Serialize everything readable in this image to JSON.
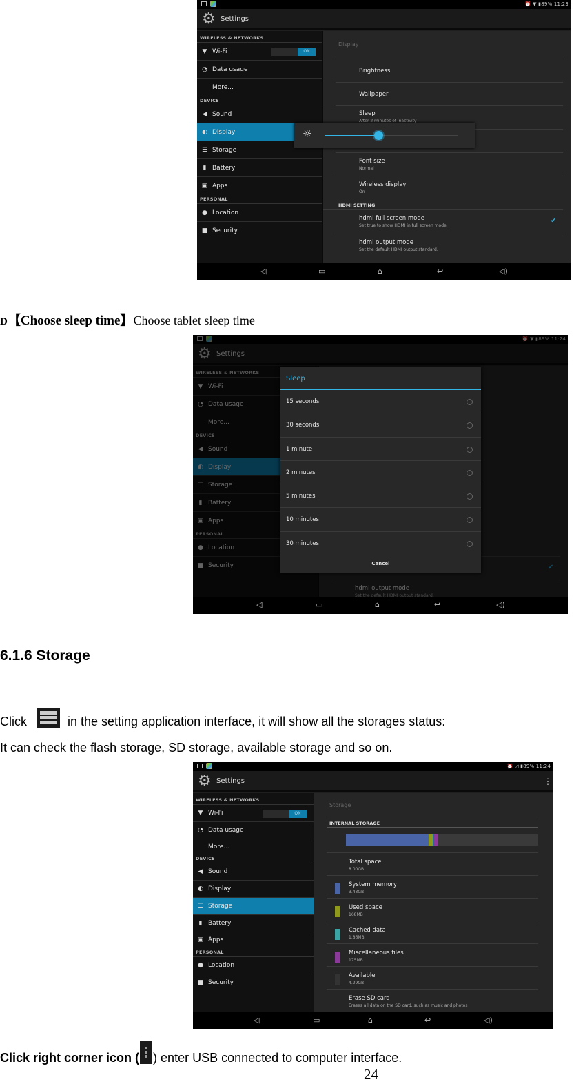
{
  "screen1": {
    "status": {
      "time": "11:23",
      "battery": "89%"
    },
    "app_title": "Settings",
    "sidebar": {
      "sections": [
        {
          "label": "WIRELESS & NETWORKS",
          "items": [
            {
              "label": "Wi-Fi",
              "icon": "wifi-icon",
              "toggle": "ON"
            },
            {
              "label": "Data usage",
              "icon": "data-usage-icon"
            },
            {
              "label": "More...",
              "icon": ""
            }
          ]
        },
        {
          "label": "DEVICE",
          "items": [
            {
              "label": "Sound",
              "icon": "sound-icon"
            },
            {
              "label": "Display",
              "icon": "display-icon",
              "selected": true
            },
            {
              "label": "Storage",
              "icon": "storage-icon"
            },
            {
              "label": "Battery",
              "icon": "battery-icon"
            },
            {
              "label": "Apps",
              "icon": "apps-icon"
            }
          ]
        },
        {
          "label": "PERSONAL",
          "items": [
            {
              "label": "Location",
              "icon": "location-icon"
            },
            {
              "label": "Security",
              "icon": "lock-icon"
            }
          ]
        }
      ]
    },
    "main": {
      "header": "Display",
      "rows": [
        {
          "title": "Brightness",
          "subtitle": ""
        },
        {
          "title": "Wallpaper",
          "subtitle": ""
        },
        {
          "title": "Sleep",
          "subtitle": "After 2 minutes of inactivity"
        },
        {
          "title": "",
          "subtitle": ""
        },
        {
          "title": "Font size",
          "subtitle": "Normal"
        },
        {
          "title": "Wireless display",
          "subtitle": "On"
        }
      ],
      "hdmi_category": "HDMI SETTING",
      "hdmi_rows": [
        {
          "title": "hdmi full screen mode",
          "subtitle": "Set true to show HDMI in full screen mode.",
          "checked": true
        },
        {
          "title": "hdmi output mode",
          "subtitle": "Set the default HDMI output standard."
        }
      ]
    },
    "brightness_popup": {
      "level_percent": 40
    }
  },
  "caption_d": {
    "prefix": "D",
    "bold": "【Choose sleep time】",
    "text": "Choose tablet sleep time"
  },
  "screen2": {
    "status": {
      "time": "11:24",
      "battery": "89%"
    },
    "app_title": "Settings",
    "dialog": {
      "title": "Sleep",
      "options": [
        "15 seconds",
        "30 seconds",
        "1 minute",
        "2 minutes",
        "5 minutes",
        "10 minutes",
        "30 minutes"
      ],
      "cancel": "Cancel"
    },
    "bg_row": {
      "title": "hdmi output mode",
      "subtitle": "Set the default HDMI output standard."
    }
  },
  "section": {
    "heading": "6.1.6 Storage",
    "line1_pre": "Click",
    "line1_post": "in the setting application interface, it will show all the storages status:",
    "line2": "It can check the flash storage, SD storage, available storage and so on."
  },
  "screen3": {
    "status": {
      "time": "11:24",
      "battery": "89%"
    },
    "app_title": "Settings",
    "main": {
      "header": "Storage",
      "category": "INTERNAL STORAGE",
      "usage_bar": [
        {
          "name": "System memory",
          "fraction": 0.429,
          "color": "#4a64a8"
        },
        {
          "name": "Used space",
          "fraction": 0.021,
          "color": "#8f9a1c"
        },
        {
          "name": "Cached data",
          "fraction": 0.006,
          "color": "#3aa3a3"
        },
        {
          "name": "Miscellaneous files",
          "fraction": 0.022,
          "color": "#8c3a9a"
        },
        {
          "name": "Available",
          "fraction": 0.522,
          "color": "#3a3a3a"
        }
      ],
      "rows": [
        {
          "title": "Total space",
          "value": "8.00GB",
          "color": ""
        },
        {
          "title": "System memory",
          "value": "3.43GB",
          "color": "#4a64a8"
        },
        {
          "title": "Used space",
          "value": "168MB",
          "color": "#8f9a1c"
        },
        {
          "title": "Cached data",
          "value": "1.86MB",
          "color": "#3aa3a3"
        },
        {
          "title": "Miscellaneous files",
          "value": "175MB",
          "color": "#8c3a9a"
        },
        {
          "title": "Available",
          "value": "4.29GB",
          "color": "#333333"
        },
        {
          "title": "Erase SD card",
          "value": "Erases all data on the SD card, such as music and photos",
          "color": ""
        }
      ]
    }
  },
  "footer": {
    "bold": "Click right corner icon (",
    "text": ") enter USB connected to computer interface.",
    "page_number": "24"
  },
  "colors": {
    "accent": "#33b5e5",
    "selected": "#0f7fad"
  }
}
